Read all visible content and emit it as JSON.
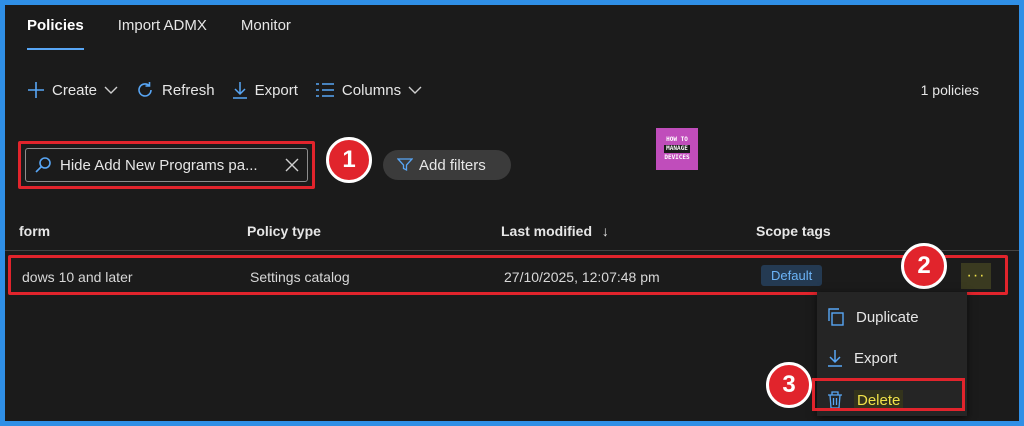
{
  "tabs": [
    {
      "label": "Policies",
      "active": true
    },
    {
      "label": "Import ADMX",
      "active": false
    },
    {
      "label": "Monitor",
      "active": false
    }
  ],
  "toolbar": {
    "create": "Create",
    "refresh": "Refresh",
    "export": "Export",
    "columns": "Columns",
    "count": "1 policies"
  },
  "search": {
    "value": "Hide Add New Programs pa..."
  },
  "filters": {
    "label": "Add filters"
  },
  "logo": {
    "line1": "HOW TO",
    "line2": "MANAGE",
    "line3": "DEVICES"
  },
  "table": {
    "headers": [
      "form",
      "Policy type",
      "Last modified",
      "Scope tags"
    ],
    "sort_arrow": "↓",
    "rows": [
      {
        "platform": "dows 10 and later",
        "policy_type": "Settings catalog",
        "last_modified": "27/10/2025, 12:07:48 pm",
        "scope_tag": "Default"
      }
    ]
  },
  "menu": {
    "items": [
      "Duplicate",
      "Export",
      "Delete"
    ]
  },
  "annotations": [
    "1",
    "2",
    "3"
  ],
  "colors": {
    "accent": "#58a6f5",
    "highlight": "#e1242c",
    "delete": "#f0e24a"
  }
}
